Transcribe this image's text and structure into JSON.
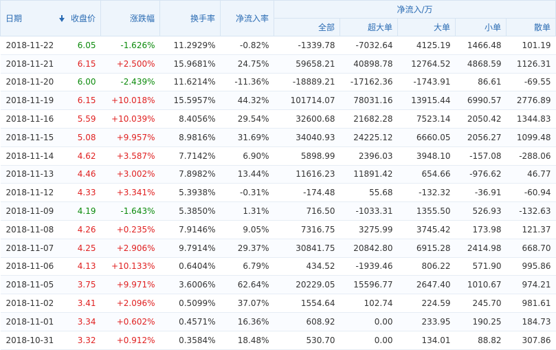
{
  "headers": {
    "date": "日期",
    "close": "收盘价",
    "change": "涨跌幅",
    "turnover": "换手率",
    "net_ratio": "净流入率",
    "net_group": "净流入/万",
    "total": "全部",
    "super_large": "超大单",
    "large": "大单",
    "small": "小单",
    "retail": "散单"
  },
  "colors": {
    "up": "#e02020",
    "down": "#0b8a0b",
    "header_text": "#2a6bb3",
    "header_bg": "#eef5fc"
  },
  "rows": [
    {
      "date": "2018-11-22",
      "close": "6.05",
      "change": "-1.626%",
      "turnover": "11.2929%",
      "net_ratio": "-0.82%",
      "total": "-1339.78",
      "super_large": "-7032.64",
      "large": "4125.19",
      "small": "1466.48",
      "retail": "101.19",
      "dir": "down"
    },
    {
      "date": "2018-11-21",
      "close": "6.15",
      "change": "+2.500%",
      "turnover": "15.9681%",
      "net_ratio": "24.75%",
      "total": "59658.21",
      "super_large": "40898.78",
      "large": "12764.52",
      "small": "4868.59",
      "retail": "1126.31",
      "dir": "up"
    },
    {
      "date": "2018-11-20",
      "close": "6.00",
      "change": "-2.439%",
      "turnover": "11.6214%",
      "net_ratio": "-11.36%",
      "total": "-18889.21",
      "super_large": "-17162.36",
      "large": "-1743.91",
      "small": "86.61",
      "retail": "-69.55",
      "dir": "down"
    },
    {
      "date": "2018-11-19",
      "close": "6.15",
      "change": "+10.018%",
      "turnover": "15.5957%",
      "net_ratio": "44.32%",
      "total": "101714.07",
      "super_large": "78031.16",
      "large": "13915.44",
      "small": "6990.57",
      "retail": "2776.89",
      "dir": "up"
    },
    {
      "date": "2018-11-16",
      "close": "5.59",
      "change": "+10.039%",
      "turnover": "8.4056%",
      "net_ratio": "29.54%",
      "total": "32600.68",
      "super_large": "21682.28",
      "large": "7523.14",
      "small": "2050.42",
      "retail": "1344.83",
      "dir": "up"
    },
    {
      "date": "2018-11-15",
      "close": "5.08",
      "change": "+9.957%",
      "turnover": "8.9816%",
      "net_ratio": "31.69%",
      "total": "34040.93",
      "super_large": "24225.12",
      "large": "6660.05",
      "small": "2056.27",
      "retail": "1099.48",
      "dir": "up"
    },
    {
      "date": "2018-11-14",
      "close": "4.62",
      "change": "+3.587%",
      "turnover": "7.7142%",
      "net_ratio": "6.90%",
      "total": "5898.99",
      "super_large": "2396.03",
      "large": "3948.10",
      "small": "-157.08",
      "retail": "-288.06",
      "dir": "up"
    },
    {
      "date": "2018-11-13",
      "close": "4.46",
      "change": "+3.002%",
      "turnover": "7.8982%",
      "net_ratio": "13.44%",
      "total": "11616.23",
      "super_large": "11891.42",
      "large": "654.66",
      "small": "-976.62",
      "retail": "46.77",
      "dir": "up"
    },
    {
      "date": "2018-11-12",
      "close": "4.33",
      "change": "+3.341%",
      "turnover": "5.3938%",
      "net_ratio": "-0.31%",
      "total": "-174.48",
      "super_large": "55.68",
      "large": "-132.32",
      "small": "-36.91",
      "retail": "-60.94",
      "dir": "up"
    },
    {
      "date": "2018-11-09",
      "close": "4.19",
      "change": "-1.643%",
      "turnover": "5.3850%",
      "net_ratio": "1.31%",
      "total": "716.50",
      "super_large": "-1033.31",
      "large": "1355.50",
      "small": "526.93",
      "retail": "-132.63",
      "dir": "down"
    },
    {
      "date": "2018-11-08",
      "close": "4.26",
      "change": "+0.235%",
      "turnover": "7.9146%",
      "net_ratio": "9.05%",
      "total": "7316.75",
      "super_large": "3275.99",
      "large": "3745.42",
      "small": "173.98",
      "retail": "121.37",
      "dir": "up"
    },
    {
      "date": "2018-11-07",
      "close": "4.25",
      "change": "+2.906%",
      "turnover": "9.7914%",
      "net_ratio": "29.37%",
      "total": "30841.75",
      "super_large": "20842.80",
      "large": "6915.28",
      "small": "2414.98",
      "retail": "668.70",
      "dir": "up"
    },
    {
      "date": "2018-11-06",
      "close": "4.13",
      "change": "+10.133%",
      "turnover": "0.6404%",
      "net_ratio": "6.79%",
      "total": "434.52",
      "super_large": "-1939.46",
      "large": "806.22",
      "small": "571.90",
      "retail": "995.86",
      "dir": "up"
    },
    {
      "date": "2018-11-05",
      "close": "3.75",
      "change": "+9.971%",
      "turnover": "3.6006%",
      "net_ratio": "62.64%",
      "total": "20229.05",
      "super_large": "15596.77",
      "large": "2647.40",
      "small": "1010.67",
      "retail": "974.21",
      "dir": "up"
    },
    {
      "date": "2018-11-02",
      "close": "3.41",
      "change": "+2.096%",
      "turnover": "0.5099%",
      "net_ratio": "37.07%",
      "total": "1554.64",
      "super_large": "102.74",
      "large": "224.59",
      "small": "245.70",
      "retail": "981.61",
      "dir": "up"
    },
    {
      "date": "2018-11-01",
      "close": "3.34",
      "change": "+0.602%",
      "turnover": "0.4571%",
      "net_ratio": "16.36%",
      "total": "608.92",
      "super_large": "0.00",
      "large": "233.95",
      "small": "190.25",
      "retail": "184.73",
      "dir": "up"
    },
    {
      "date": "2018-10-31",
      "close": "3.32",
      "change": "+0.912%",
      "turnover": "0.3584%",
      "net_ratio": "18.48%",
      "total": "530.70",
      "super_large": "0.00",
      "large": "134.01",
      "small": "88.82",
      "retail": "307.86",
      "dir": "up"
    }
  ]
}
